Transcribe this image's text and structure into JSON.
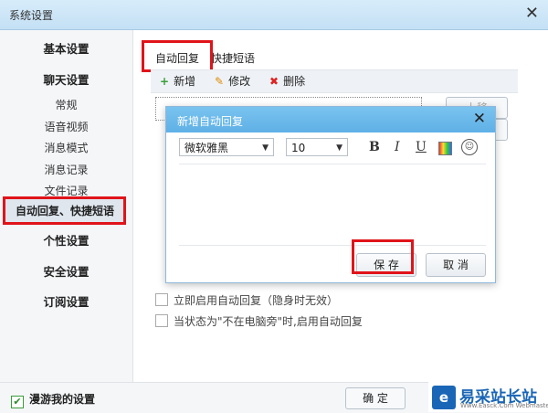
{
  "window": {
    "title": "系统设置"
  },
  "sidebar": {
    "items": [
      {
        "label": "基本设置"
      },
      {
        "label": "聊天设置"
      },
      {
        "label": "常规"
      },
      {
        "label": "语音视频"
      },
      {
        "label": "消息模式"
      },
      {
        "label": "消息记录"
      },
      {
        "label": "文件记录"
      },
      {
        "label": "自动回复、快捷短语"
      },
      {
        "label": "个性设置"
      },
      {
        "label": "安全设置"
      },
      {
        "label": "订阅设置"
      }
    ]
  },
  "tabs": [
    {
      "label": "自动回复"
    },
    {
      "label": "快捷短语"
    }
  ],
  "toolbar": {
    "add": "新增",
    "add_icon": "+",
    "edit": "修改",
    "edit_icon": "✎",
    "delete": "删除",
    "delete_icon": "✖"
  },
  "side_buttons": [
    {
      "label": "上移"
    },
    {
      "label": ""
    }
  ],
  "options": [
    {
      "label": "立即启用自动回复（隐身时无效）"
    },
    {
      "label": "当状态为\"不在电脑旁\"时,启用自动回复"
    }
  ],
  "dialog": {
    "title": "新增自动回复",
    "font_family": "微软雅黑",
    "font_size": "10",
    "bold": "B",
    "italic": "I",
    "underline": "U",
    "save": "保 存",
    "cancel": "取 消"
  },
  "footer": {
    "roam_label": "漫游我的设置",
    "ok_label": "确 定"
  },
  "watermark": {
    "name": "易采站长站",
    "sub": "Www.Easck.Com  Webmaster"
  },
  "colors": {
    "highlight_border": "#e0141a",
    "dialog_title": "#6ab9eb",
    "brand_blue": "#1a66b6"
  }
}
